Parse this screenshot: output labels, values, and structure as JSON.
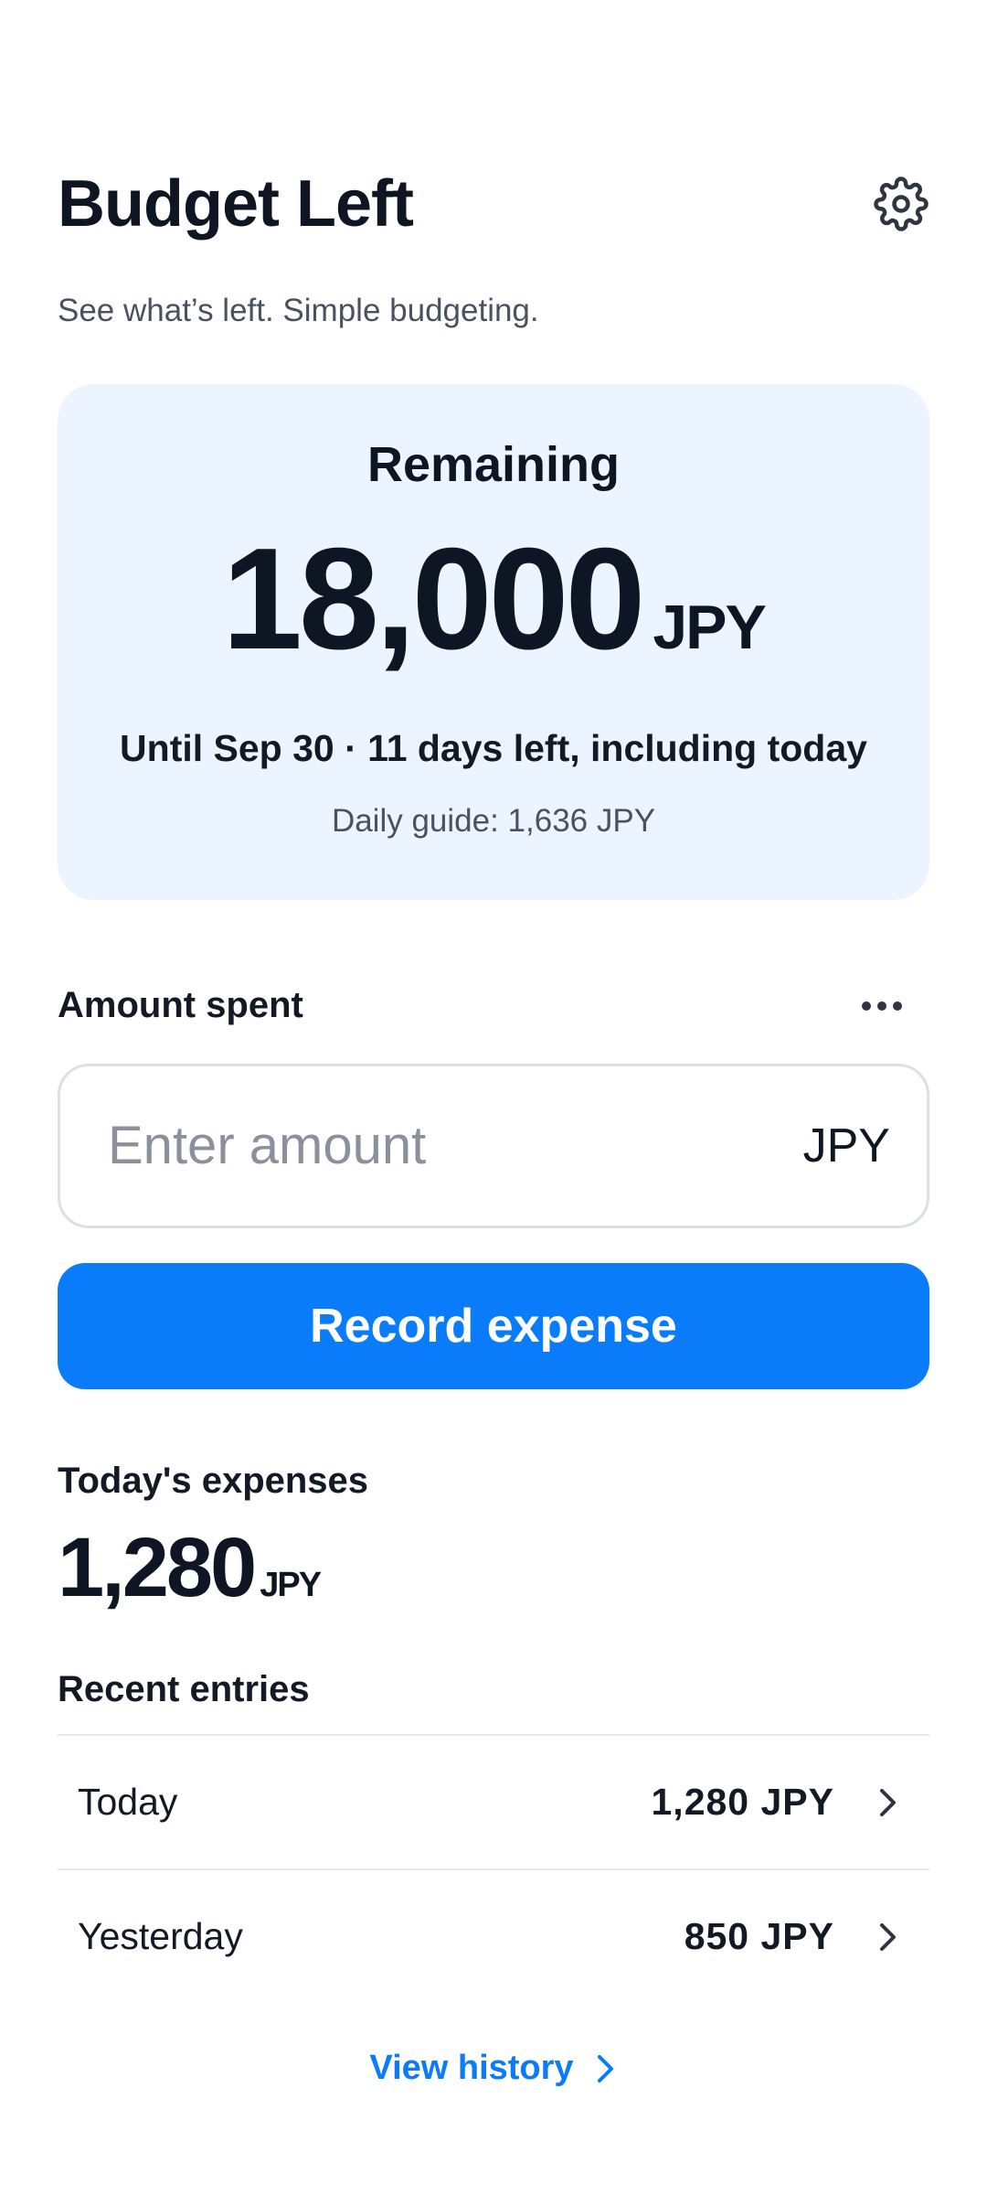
{
  "header": {
    "title": "Budget Left",
    "subtitle": "See what’s left. Simple budgeting."
  },
  "remaining": {
    "label": "Remaining",
    "amount": "18,000",
    "unit": "JPY",
    "until": "Until Sep 30 · 11 days left, including today",
    "daily_guide": "Daily guide: 1,636 JPY"
  },
  "spent": {
    "label": "Amount spent",
    "placeholder": "Enter amount",
    "unit": "JPY",
    "button": "Record expense"
  },
  "today": {
    "label": "Today's expenses",
    "amount": "1,280",
    "unit": "JPY"
  },
  "recent": {
    "label": "Recent entries",
    "entries": [
      {
        "label": "Today",
        "amount": "1,280 JPY"
      },
      {
        "label": "Yesterday",
        "amount": "850 JPY"
      }
    ]
  },
  "history_link": "View history",
  "icons": {
    "settings": "gear-icon",
    "more": "more-horizontal-icon",
    "chevron": "chevron-right-icon"
  },
  "colors": {
    "accent": "#0a7cfa",
    "card_bg": "#ebf4ff",
    "text": "#0f1623"
  }
}
